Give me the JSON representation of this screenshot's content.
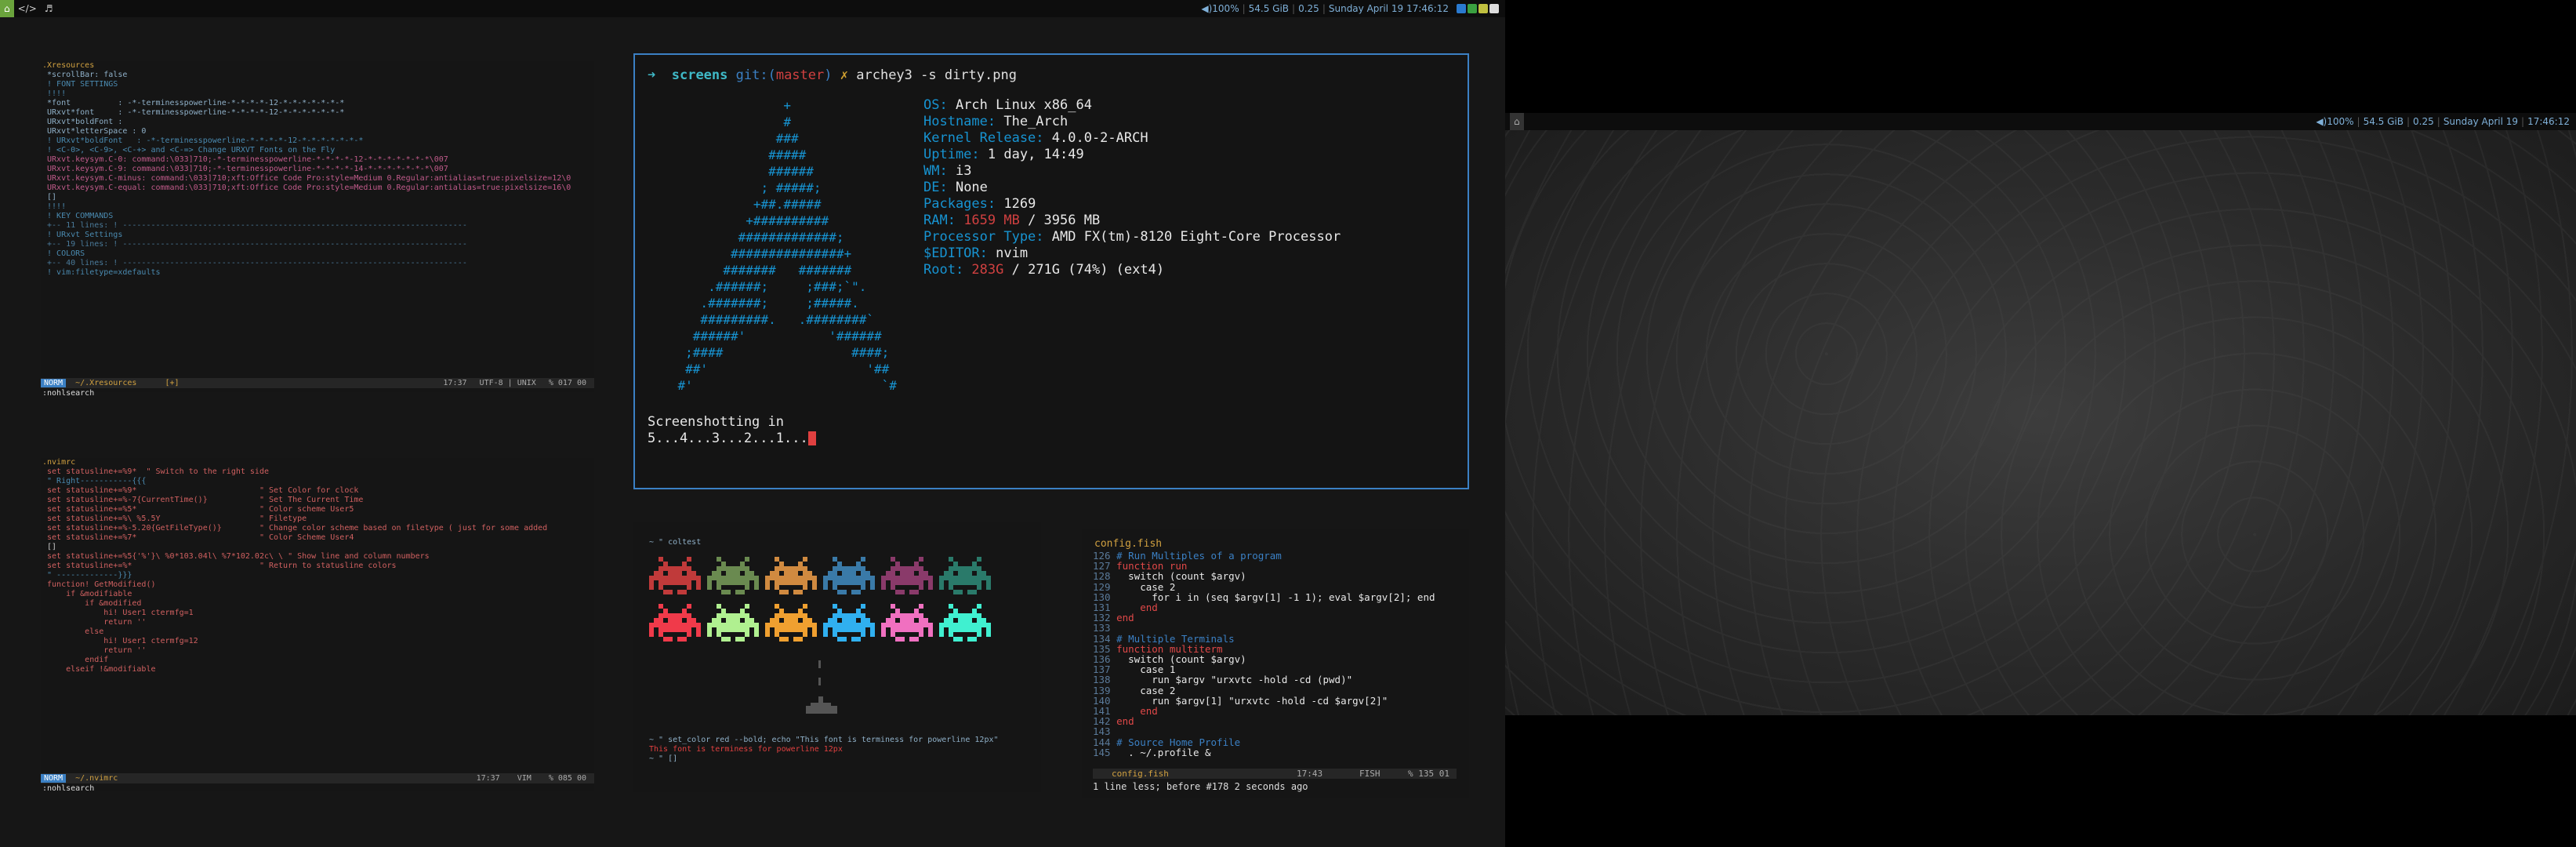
{
  "left_bar": {
    "workspaces": [
      "",
      "</>",
      "♬"
    ],
    "volume": "◀)100%",
    "memory": "54.5 GiB",
    "load": "0.25",
    "date": "Sunday April 19",
    "time": "17:46:12"
  },
  "right_bar": {
    "volume": "◀)100%",
    "memory": "54.5 GiB",
    "load": "0.25",
    "date": "Sunday April 19",
    "time": "17:46:12"
  },
  "terminal": {
    "prompt_arrow": "➜",
    "prompt_dir": "screens",
    "prompt_git": "git:(",
    "prompt_branch": "master",
    "prompt_git_close": ")",
    "prompt_dirty": "✗",
    "prompt_cmd": "archey3 -s dirty.png",
    "logo": "                  +\n                  #\n                 ###\n                #####\n                ######\n               ; #####;\n              +##.#####\n             +##########\n            #############;\n           ###############+\n          #######   #######\n        .######;     ;###;`\".\n       .#######;     ;#####.\n       #########.   .########`\n      ######'           '######\n     ;####                 ####;\n     ##'                     '##\n    #'                         `#",
    "info": [
      {
        "key": "OS:",
        "value": "Arch Linux x86_64"
      },
      {
        "key": "Hostname:",
        "value": "The_Arch"
      },
      {
        "key": "Kernel Release:",
        "value": "4.0.0-2-ARCH"
      },
      {
        "key": "Uptime:",
        "value": "1 day, 14:49"
      },
      {
        "key": "WM:",
        "value": "i3"
      },
      {
        "key": "DE:",
        "value": "None"
      },
      {
        "key": "Packages:",
        "value": "1269"
      },
      {
        "key": "RAM:",
        "used": "1659 MB",
        "value": " / 3956 MB"
      },
      {
        "key": "Processor Type:",
        "value": "AMD FX(tm)-8120 Eight-Core Processor"
      },
      {
        "key": "$EDITOR:",
        "value": "nvim"
      },
      {
        "key": "Root:",
        "used": "283G",
        "value": " / 271G (74%) (ext4)"
      }
    ],
    "shot_line1": "Screenshotting in",
    "shot_line2": "5...4...3...2...1..."
  },
  "xresources": {
    "lines": [
      ".Xresources",
      " *scrollBar: false",
      "",
      " ! FONT SETTINGS",
      " !!!!",
      "",
      " *font          : -*-terminesspowerline-*-*-*-*-12-*-*-*-*-*-*-*",
      " URxvt*font     : -*-terminesspowerline-*-*-*-*-12-*-*-*-*-*-*-*",
      " URxvt*boldFont :",
      " URxvt*letterSpace : 0",
      " ! URxvt*boldFont   : -*-terminesspowerline-*-*-*-*-12-*-*-*-*-*-*-*",
      "",
      " ! <C-0>, <C-9>, <C-+> and <C-=> Change URXVT Fonts on the Fly",
      " URxvt.keysym.C-0: command:\\033]710;-*-terminesspowerline-*-*-*-*-12-*-*-*-*-*-*-*\\007",
      " URxvt.keysym.C-9: command:\\033]710;-*-terminesspowerline-*-*-*-*-14-*-*-*-*-*-*-*\\007",
      " URxvt.keysym.C-minus: command:\\033]710;xft:Office Code Pro:style=Medium 0.Regular:antialias=true:pixelsize=12\\0",
      " URxvt.keysym.C-equal: command:\\033]710;xft:Office Code Pro:style=Medium 0.Regular:antialias=true:pixelsize=16\\0",
      " []",
      " !!!!",
      "",
      " ! KEY COMMANDS",
      " +-- 11 lines: ! -------------------------------------------------------------------------",
      "",
      " ! URxvt Settings",
      " +-- 19 lines: ! -------------------------------------------------------------------------",
      "",
      " ! COLORS",
      " +-- 40 lines: ! -------------------------------------------------------------------------",
      "",
      " ! vim:filetype=xdefaults"
    ],
    "status_mode": "NORM",
    "status_file": "~/.Xresources",
    "status_mod": "[+]",
    "status_time": "17:37",
    "status_enc": "UTF-8 | UNIX",
    "status_pos": "% 017 00",
    "cmdline": ":nohlsearch"
  },
  "nvimrc": {
    "lines": [
      ".nvimrc",
      " set statusline+=%9*  \" Switch to the right side",
      "",
      " \" Right-----------{{{",
      "",
      " set statusline+=%9*                          \" Set Color for clock",
      "",
      " set statusline+=%-7{CurrentTime()}           \" Set The Current Time",
      "",
      " set statusline+=%5*                          \" Color scheme User5",
      "",
      " set statusline+=%\\ %5.5Y                     \" Filetype",
      "",
      " set statusline+=%-5.20{GetFileType()}        \" Change color scheme based on filetype ( just for some added",
      "",
      " set statusline+=%7*                          \" Color Scheme User4",
      " []",
      " set statusline+=%5{'%'}\\ %0*103.04l\\ %7*102.02c\\ \\ \" Show line and column numbers",
      "",
      " set statusline+=%*                           \" Return to statusline colors",
      "",
      " \" -------------}}}",
      "",
      " function! GetModified()",
      "     if &modifiable",
      "         if &modified",
      "             hi! User1 ctermfg=1",
      "             return ''",
      "         else",
      "             hi! User1 ctermfg=12",
      "             return ''",
      "         endif",
      "     elseif !&modifiable"
    ],
    "status_mode": "NORM",
    "status_file": "~/.nvimrc",
    "status_time": "17:37",
    "status_ft": "VIM",
    "status_pos": "% 085 00",
    "cmdline": ":nohlsearch"
  },
  "colortest": {
    "prompt": "~ \" coltest",
    "cmd": "~ \" set_color red --bold; echo \"This font is terminess for powerline 12px\"",
    "output": "This font is terminess for powerline 12px",
    "prompt2": "~ \" []",
    "invaders_top": [
      "#c03a3a",
      "#6a8a50",
      "#d08a40",
      "#3a7aa8",
      "#8a3a6a",
      "#2a7a6a"
    ],
    "invaders_bottom": [
      "#f03a4a",
      "#b0f090",
      "#f0a030",
      "#30b0f0",
      "#f070c0",
      "#40f0d0"
    ]
  },
  "fish": {
    "title": "config.fish",
    "lines": [
      {
        "n": "126",
        "t": "# Run Multiples of a program",
        "c": "cm"
      },
      {
        "n": "127",
        "t": "function run",
        "c": "kw"
      },
      {
        "n": "128",
        "t": "  switch (count $argv)",
        "c": ""
      },
      {
        "n": "129",
        "t": "    case 2",
        "c": ""
      },
      {
        "n": "130",
        "t": "      for i in (seq $argv[1] -1 1); eval $argv[2]; end",
        "c": ""
      },
      {
        "n": "131",
        "t": "    end",
        "c": "kw"
      },
      {
        "n": "132",
        "t": "end",
        "c": "kw"
      },
      {
        "n": "133",
        "t": "",
        "c": ""
      },
      {
        "n": "134",
        "t": "# Multiple Terminals",
        "c": "cm"
      },
      {
        "n": "135",
        "t": "function multiterm",
        "c": "kw"
      },
      {
        "n": "136",
        "t": "  switch (count $argv)",
        "c": ""
      },
      {
        "n": "137",
        "t": "    case 1",
        "c": ""
      },
      {
        "n": "138",
        "t": "      run $argv \"urxvtc -hold -cd (pwd)\"",
        "c": ""
      },
      {
        "n": "139",
        "t": "    case 2",
        "c": ""
      },
      {
        "n": "140",
        "t": "      run $argv[1] \"urxvtc -hold -cd $argv[2]\"",
        "c": ""
      },
      {
        "n": "141",
        "t": "    end",
        "c": "kw"
      },
      {
        "n": "142",
        "t": "end",
        "c": "kw"
      },
      {
        "n": "143",
        "t": "",
        "c": ""
      },
      {
        "n": "144",
        "t": "# Source Home Profile",
        "c": "cm"
      },
      {
        "n": "145",
        "t": "  . ~/.profile &",
        "c": ""
      }
    ],
    "status_file": "config.fish",
    "status_time": "17:43",
    "status_ft": "FISH",
    "status_pos": "% 135 01",
    "cmdline": "1 line less; before #178  2 seconds ago"
  }
}
